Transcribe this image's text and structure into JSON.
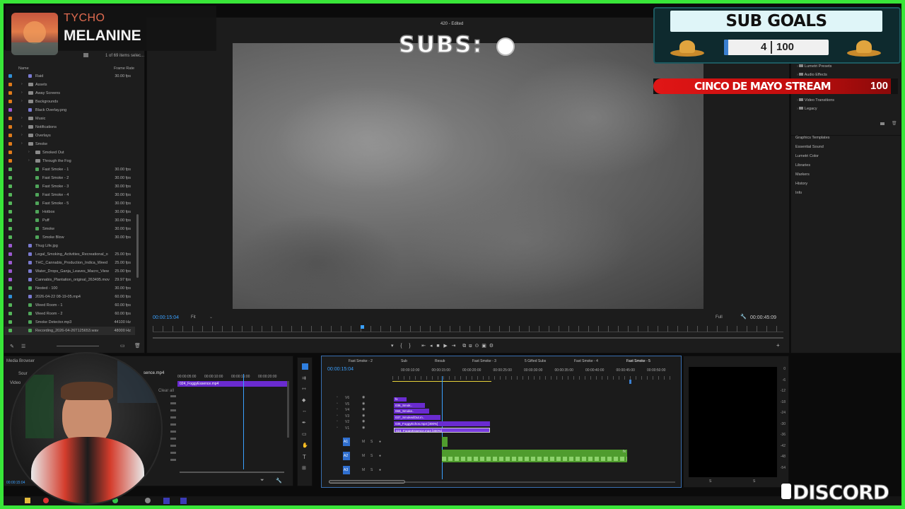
{
  "now_playing": {
    "artist": "TYCHO",
    "title": "MELANINE"
  },
  "program": {
    "window_title": "420 - Edited",
    "timecode": "00:00:15:04",
    "fit": "Fit",
    "quality": "Full",
    "duration": "00:00:45:09"
  },
  "overlay": {
    "subs_label": "SUBS:",
    "subs_icon": "cannabis-leaf-icon"
  },
  "sub_goals": {
    "title": "SUB GOALS",
    "current": "4",
    "goal": "100",
    "stream_title": "CINCO DE MAYO STREAM",
    "stream_value": "100"
  },
  "project": {
    "items_count": "1 of 69 items selec...",
    "col_name": "Name",
    "col_rate": "Frame Rate",
    "rows": [
      {
        "label": "Raid",
        "rate": "30.00 fps",
        "color": "#2f8fd6",
        "kind": "clip",
        "indent": 0
      },
      {
        "label": "Assets",
        "rate": "",
        "color": "#e07b1a",
        "kind": "folder",
        "indent": 0
      },
      {
        "label": "Away Screens",
        "rate": "",
        "color": "#e07b1a",
        "kind": "folder",
        "indent": 0
      },
      {
        "label": "Backgrounds",
        "rate": "",
        "color": "#e07b1a",
        "kind": "folder",
        "indent": 0
      },
      {
        "label": "Black Overlay.png",
        "rate": "",
        "color": "#9b59d0",
        "kind": "image",
        "indent": 0
      },
      {
        "label": "Music",
        "rate": "",
        "color": "#e07b1a",
        "kind": "folder",
        "indent": 0
      },
      {
        "label": "Notifications",
        "rate": "",
        "color": "#e07b1a",
        "kind": "folder",
        "indent": 0
      },
      {
        "label": "Overlays",
        "rate": "",
        "color": "#e07b1a",
        "kind": "folder",
        "indent": 0
      },
      {
        "label": "Smoke",
        "rate": "",
        "color": "#e07b1a",
        "kind": "folder",
        "indent": 0
      },
      {
        "label": "Smoked Out",
        "rate": "",
        "color": "#e07b1a",
        "kind": "folder",
        "indent": 1
      },
      {
        "label": "Through the Fog",
        "rate": "",
        "color": "#e07b1a",
        "kind": "folder",
        "indent": 1
      },
      {
        "label": "Fast Smoke - 1",
        "rate": "30.00 fps",
        "color": "#55b55a",
        "kind": "seq",
        "indent": 1
      },
      {
        "label": "Fast Smoke - 2",
        "rate": "30.00 fps",
        "color": "#55b55a",
        "kind": "seq",
        "indent": 1
      },
      {
        "label": "Fast Smoke - 3",
        "rate": "30.00 fps",
        "color": "#55b55a",
        "kind": "seq",
        "indent": 1
      },
      {
        "label": "Fast Smoke - 4",
        "rate": "30.00 fps",
        "color": "#55b55a",
        "kind": "seq",
        "indent": 1
      },
      {
        "label": "Fast Smoke - 5",
        "rate": "30.00 fps",
        "color": "#55b55a",
        "kind": "seq",
        "indent": 1
      },
      {
        "label": "Hotbox",
        "rate": "30.00 fps",
        "color": "#55b55a",
        "kind": "seq",
        "indent": 1
      },
      {
        "label": "Puff",
        "rate": "30.00 fps",
        "color": "#55b55a",
        "kind": "seq",
        "indent": 1
      },
      {
        "label": "Smoke",
        "rate": "30.00 fps",
        "color": "#55b55a",
        "kind": "seq",
        "indent": 1
      },
      {
        "label": "Smoke Blow",
        "rate": "30.00 fps",
        "color": "#55b55a",
        "kind": "seq",
        "indent": 1
      },
      {
        "label": "Thug Life.jpg",
        "rate": "",
        "color": "#9b59d0",
        "kind": "image",
        "indent": 0
      },
      {
        "label": "Legal_Smoking_Activities_Recreational_o",
        "rate": "25.00 fps",
        "color": "#9b59d0",
        "kind": "clip",
        "indent": 0
      },
      {
        "label": "THC_Cannabis_Production_Indica_Weed",
        "rate": "25.00 fps",
        "color": "#9b59d0",
        "kind": "clip",
        "indent": 0
      },
      {
        "label": "Water_Drops_Ganja_Leaves_Macro_View",
        "rate": "25.00 fps",
        "color": "#9b59d0",
        "kind": "clip",
        "indent": 0
      },
      {
        "label": "Cannabis_Plantation_original_263495.mov",
        "rate": "29.97 fps",
        "color": "#9b59d0",
        "kind": "clip",
        "indent": 0
      },
      {
        "label": "Nested - 100",
        "rate": "30.00 fps",
        "color": "#55b55a",
        "kind": "seq",
        "indent": 0
      },
      {
        "label": "2026-04-22 08-19-05.mp4",
        "rate": "60.00 fps",
        "color": "#2f8fd6",
        "kind": "clip",
        "indent": 0
      },
      {
        "label": "Weed Room - 1",
        "rate": "60.00 fps",
        "color": "#55b55a",
        "kind": "seq",
        "indent": 0
      },
      {
        "label": "Weed Room - 2",
        "rate": "60.00 fps",
        "color": "#55b55a",
        "kind": "seq",
        "indent": 0
      },
      {
        "label": "Smoke Detector.mp3",
        "rate": "44100 Hz",
        "color": "#55b55a",
        "kind": "audio",
        "indent": 0
      },
      {
        "label": "Recording_2026-04-26T125653.wav",
        "rate": "48000 Hz",
        "color": "#55b55a",
        "kind": "audio",
        "indent": 0
      }
    ]
  },
  "effects": {
    "items": [
      "Lumetri Presets",
      "Audio Effects",
      "Video Transitions",
      "Legacy"
    ],
    "panels": [
      "Graphics Templates",
      "Essential Sound",
      "Lumetri Color",
      "Libraries",
      "Markers",
      "History",
      "Info"
    ]
  },
  "source_panel": {
    "label1": "Media Browser",
    "label2": "Sour",
    "label3": "Video",
    "clip_tab": "sence.mp4",
    "clip_name": "024_FoggyEssence.mp4",
    "ticks": [
      "00:00:05:00",
      "00:00:10:00",
      "00:00:15:00",
      "00:00:20:00"
    ],
    "clear": "Clear all",
    "tc_small": "00:00:15:04"
  },
  "timeline": {
    "tabs": [
      "Fast Smoke - 2",
      "Sub",
      "Resub",
      "Fast Smoke - 3",
      "5 Gifted Subs",
      "Fast Smoke - 4",
      "Fast Smoke - 5"
    ],
    "timecode": "00:00:15:04",
    "ruler": [
      "00:00:10:00",
      "00:00:15:00",
      "00:00:20:00",
      "00:00:25:00",
      "00:00:30:00",
      "00:00:35:00",
      "00:00:40:00",
      "00:00:45:00",
      "00:00:50:00"
    ],
    "video_tracks": [
      "V6",
      "V5",
      "V4",
      "V3",
      "V2",
      "V1"
    ],
    "audio_tracks": [
      "A1",
      "A2",
      "A3"
    ],
    "clips": [
      "036_Smok..",
      "065_Smoke..",
      "037_SmokedOut.m..",
      "036_FoggyEchos.mp4 [300%]",
      "024_FoggyEssence.mp4 [300%]"
    ],
    "fx": "fx",
    "meter": [
      "0",
      "-6",
      "-12",
      "-18",
      "-24",
      "-30",
      "-36",
      "-42",
      "-48",
      "-54"
    ],
    "meter_lr": [
      "S",
      "S"
    ],
    "track_btns": {
      "mute": "M",
      "solo": "S"
    }
  },
  "discord": {
    "text": "DISCORD"
  }
}
